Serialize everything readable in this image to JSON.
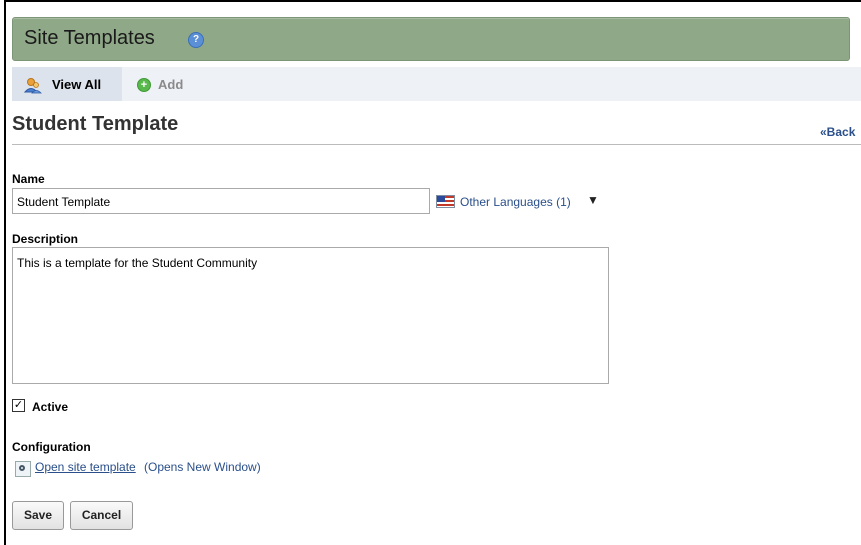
{
  "header": {
    "title": "Site Templates",
    "help_icon": "help-icon"
  },
  "toolbar": {
    "view_all_label": "View All",
    "add_label": "Add"
  },
  "page": {
    "title": "Student Template",
    "back_label": "«Back"
  },
  "form": {
    "name_label": "Name",
    "name_value": "Student Template",
    "other_languages_label": "Other Languages (1)",
    "description_label": "Description",
    "description_value": "This is a template for the Student Community",
    "active_label": "Active",
    "active_checked": true,
    "configuration_label": "Configuration",
    "open_template_link": "Open site template",
    "open_template_note": "(Opens New Window)"
  },
  "buttons": {
    "save_label": "Save",
    "cancel_label": "Cancel"
  },
  "colors": {
    "header_bg": "#8fa888",
    "link": "#2a4f8a",
    "toolbar_bg": "#eef1f6"
  }
}
